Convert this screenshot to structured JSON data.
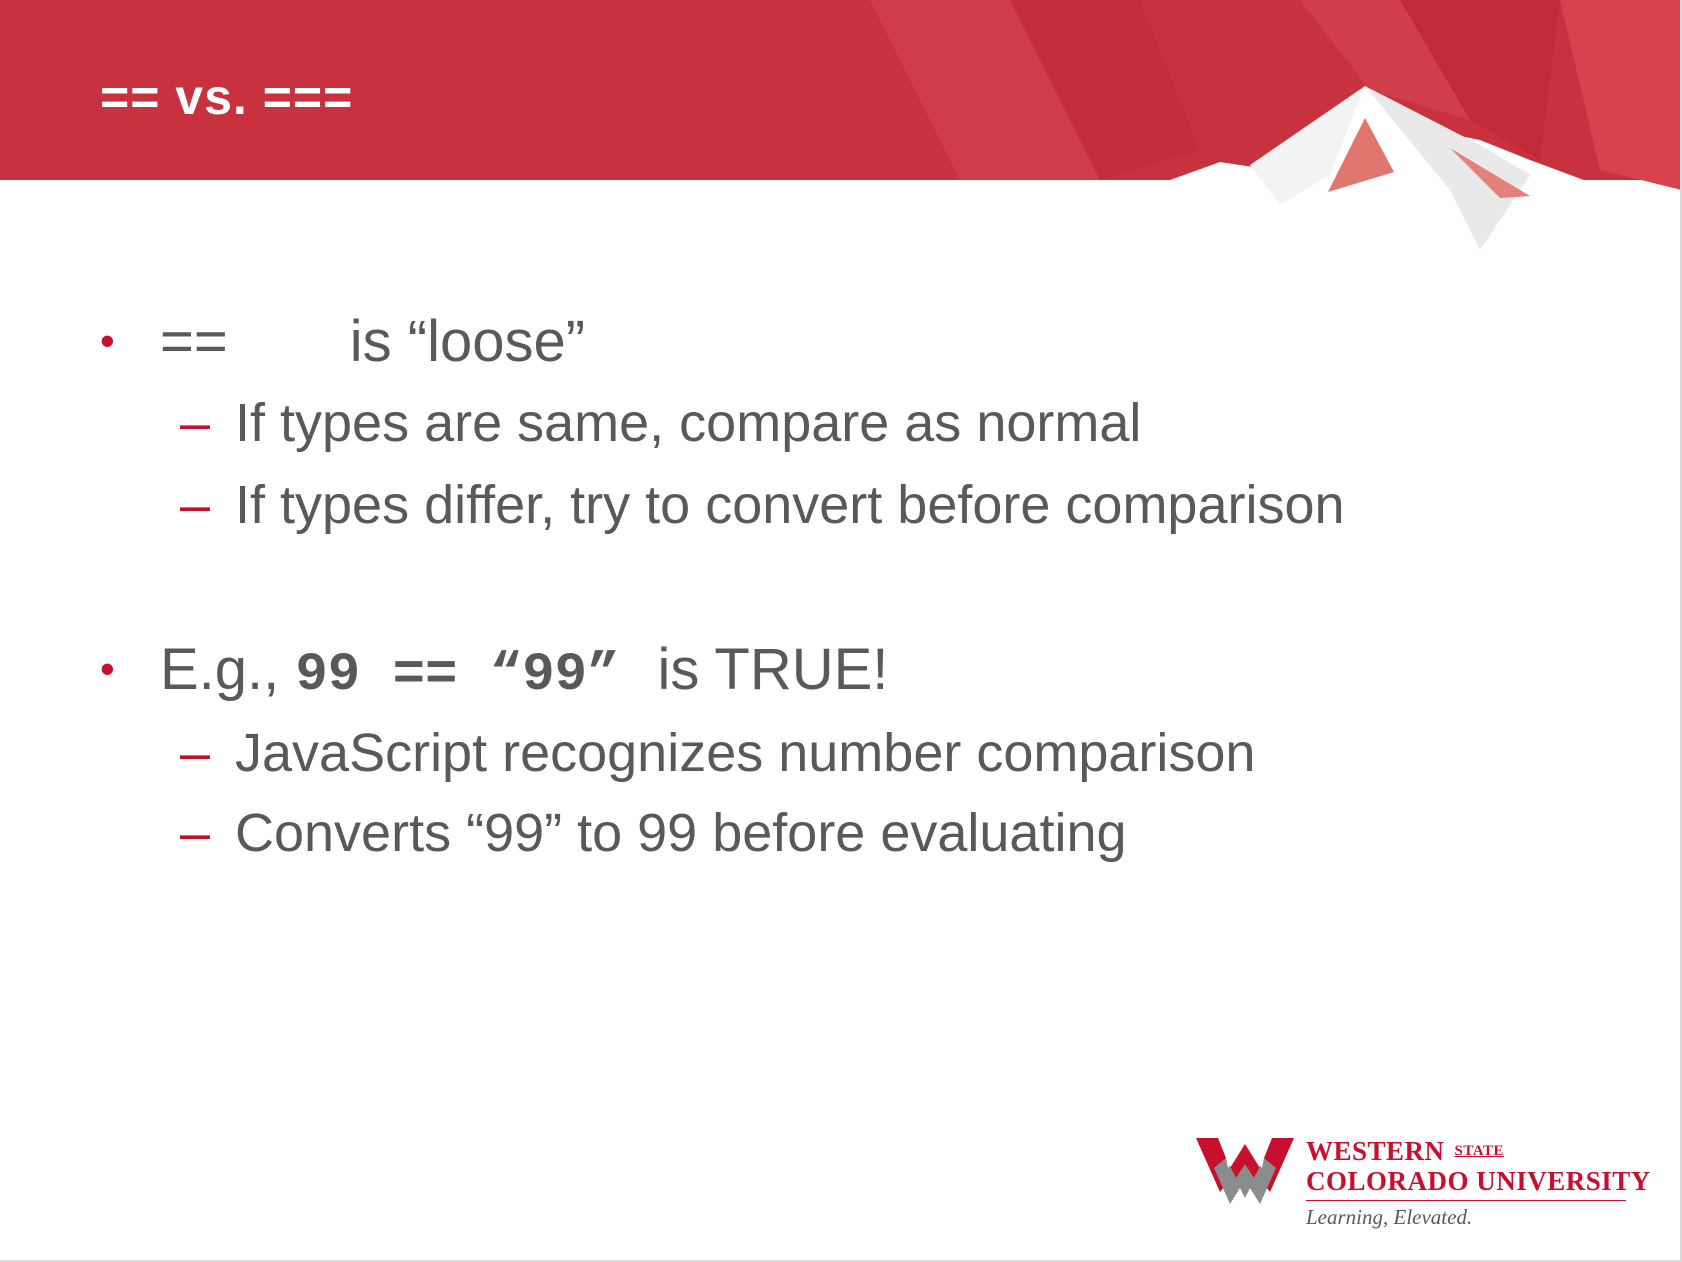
{
  "slide": {
    "title": "== vs. ===",
    "bullets": [
      {
        "op": "==",
        "text": "is “loose”",
        "subs": [
          "If types are same, compare as normal",
          "If types differ, try to convert before comparison"
        ]
      },
      {
        "prefix": "E.g., ",
        "code": "99 == “99”",
        "suffix": "is TRUE!",
        "subs": [
          "JavaScript recognizes number comparison",
          "Converts “99” to 99 before evaluating"
        ]
      }
    ],
    "bullet_glyph": "•",
    "dash_glyph": "–"
  },
  "logo": {
    "line1": "WESTERN",
    "state": "STATE",
    "line2": "COLORADO UNIVERSITY",
    "tagline": "Learning, Elevated."
  },
  "colors": {
    "brand_red": "#c8102e",
    "header_red": "#c8323e",
    "text_gray": "#58595b"
  }
}
